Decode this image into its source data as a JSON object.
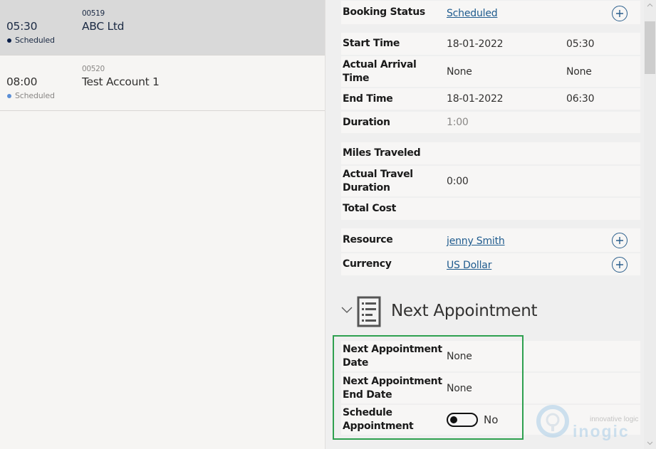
{
  "bookings": [
    {
      "time": "05:30",
      "status": "Scheduled",
      "number": "00519",
      "name": "ABC Ltd",
      "selected": true,
      "dot_color": "#0b1f48"
    },
    {
      "time": "08:00",
      "status": "Scheduled",
      "number": "00520",
      "name": "Test Account 1",
      "selected": false,
      "dot_color": "#5b8fd6"
    }
  ],
  "form": {
    "booking_status": {
      "label": "Booking Status",
      "value": "Scheduled"
    },
    "start_time": {
      "label": "Start Time",
      "date": "18-01-2022",
      "time": "05:30"
    },
    "actual_arrival": {
      "label": "Actual Arrival Time",
      "date": "None",
      "time": "None"
    },
    "end_time": {
      "label": "End Time",
      "date": "18-01-2022",
      "time": "06:30"
    },
    "duration": {
      "label": "Duration",
      "value": "1:00"
    },
    "miles_traveled": {
      "label": "Miles Traveled",
      "value": ""
    },
    "actual_travel_duration": {
      "label": "Actual Travel Duration",
      "value": "0:00"
    },
    "total_cost": {
      "label": "Total Cost",
      "value": ""
    },
    "resource": {
      "label": "Resource",
      "value": "jenny Smith"
    },
    "currency": {
      "label": "Currency",
      "value": "US Dollar"
    }
  },
  "next_appointment": {
    "title": "Next Appointment",
    "date": {
      "label": "Next Appointment Date",
      "value": "None"
    },
    "end_date": {
      "label": "Next Appointment End Date",
      "value": "None"
    },
    "schedule": {
      "label": "Schedule Appointment",
      "value": "No",
      "on": false
    }
  },
  "watermark": {
    "tagline": "innovative logic",
    "brand": "inogic"
  },
  "colors": {
    "link": "#1f5b8e",
    "highlight": "#2ea04f",
    "selected_row": "#d9d9d9"
  }
}
